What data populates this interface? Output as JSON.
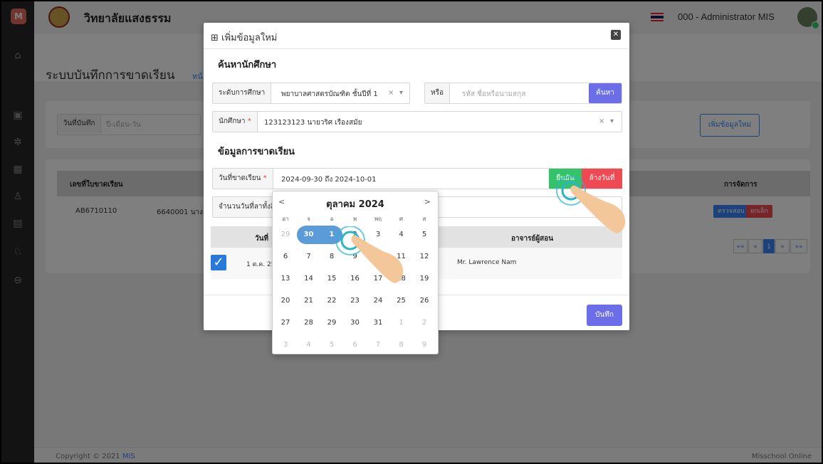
{
  "sidebar": {
    "logo": "M",
    "icons": [
      "home-icon",
      "report-icon",
      "users-group-icon",
      "calendar-icon",
      "person-add-icon",
      "document-icon",
      "user-settings-icon",
      "logout-icon"
    ]
  },
  "topbar": {
    "school_name": "วิทยาลัยแสงธรรม",
    "admin_name": "000 - Administrator MIS"
  },
  "page": {
    "title": "ระบบบันทึกการขาดเรียน",
    "crumb": "หน้",
    "filter": {
      "label": "วันที่บันทึก",
      "placeholder": "ปี-เดือน-วัน"
    },
    "add_button": "เพิ่มข้อมูลใหม่",
    "table": {
      "headers": [
        "เลขที่ใบขาดเรียน",
        "การจัดการ"
      ],
      "rows": [
        {
          "no": "AB6710110",
          "student_partial": "6640001 นาง"
        }
      ],
      "row_actions": [
        "ตรวจสอบ",
        "ยกเลิก"
      ]
    },
    "pagination": [
      "««",
      "«",
      "1",
      "»",
      "»»"
    ]
  },
  "footer": {
    "copyright": "Copyright © 2021 ",
    "brand": "MIS",
    "right": "Misschool Online"
  },
  "modal": {
    "title": "เพิ่มข้อมูลใหม่",
    "search_title": "ค้นหานักศึกษา",
    "level_label": "ระดับการศึกษา",
    "level_value": "พยาบาลศาสตรบัณฑิต ชั้นปีที่ 1",
    "or_label": "หรือ",
    "search_placeholder": "รหัส ชื่อหรือนามสกุล",
    "search_button": "ค้นหา",
    "student_label": "นักศึกษา",
    "student_value": "123123123 นายวริศ เรืองสมัย",
    "absence_title": "ข้อมูลการขาดเรียน",
    "absence_date_label": "วันที่ขาดเรียน",
    "absence_date_value": "2024-09-30 ถึง 2024-10-01",
    "confirm_button": "ยืนยัน",
    "clear_button": "ล้างวันที่",
    "total_days_label": "จำนวนวันที่ลาทั้งสิ้",
    "table_headers": {
      "date": "วันที่",
      "teacher": "อาจารย์ผู้สอน"
    },
    "table_row": {
      "date": "1 ต.ค. 25",
      "teacher": "Mr. Lawrence Nam"
    },
    "save_button": "บันทึก"
  },
  "calendar": {
    "month_title": "ตุลาคม 2024",
    "prev": "<",
    "next": ">",
    "dow": [
      "อา",
      "จ",
      "อ",
      "พ",
      "พฤ",
      "ศ",
      "ส"
    ],
    "weeks": [
      [
        "29",
        "30",
        "1",
        "2",
        "3",
        "4",
        "5"
      ],
      [
        "6",
        "7",
        "8",
        "9",
        "10",
        "11",
        "12"
      ],
      [
        "13",
        "14",
        "15",
        "16",
        "17",
        "18",
        "19"
      ],
      [
        "20",
        "21",
        "22",
        "23",
        "24",
        "25",
        "26"
      ],
      [
        "27",
        "28",
        "29",
        "30",
        "31",
        "1",
        "2"
      ],
      [
        "3",
        "4",
        "5",
        "6",
        "7",
        "8",
        "9"
      ]
    ],
    "selected_range": [
      "30",
      "1"
    ]
  }
}
